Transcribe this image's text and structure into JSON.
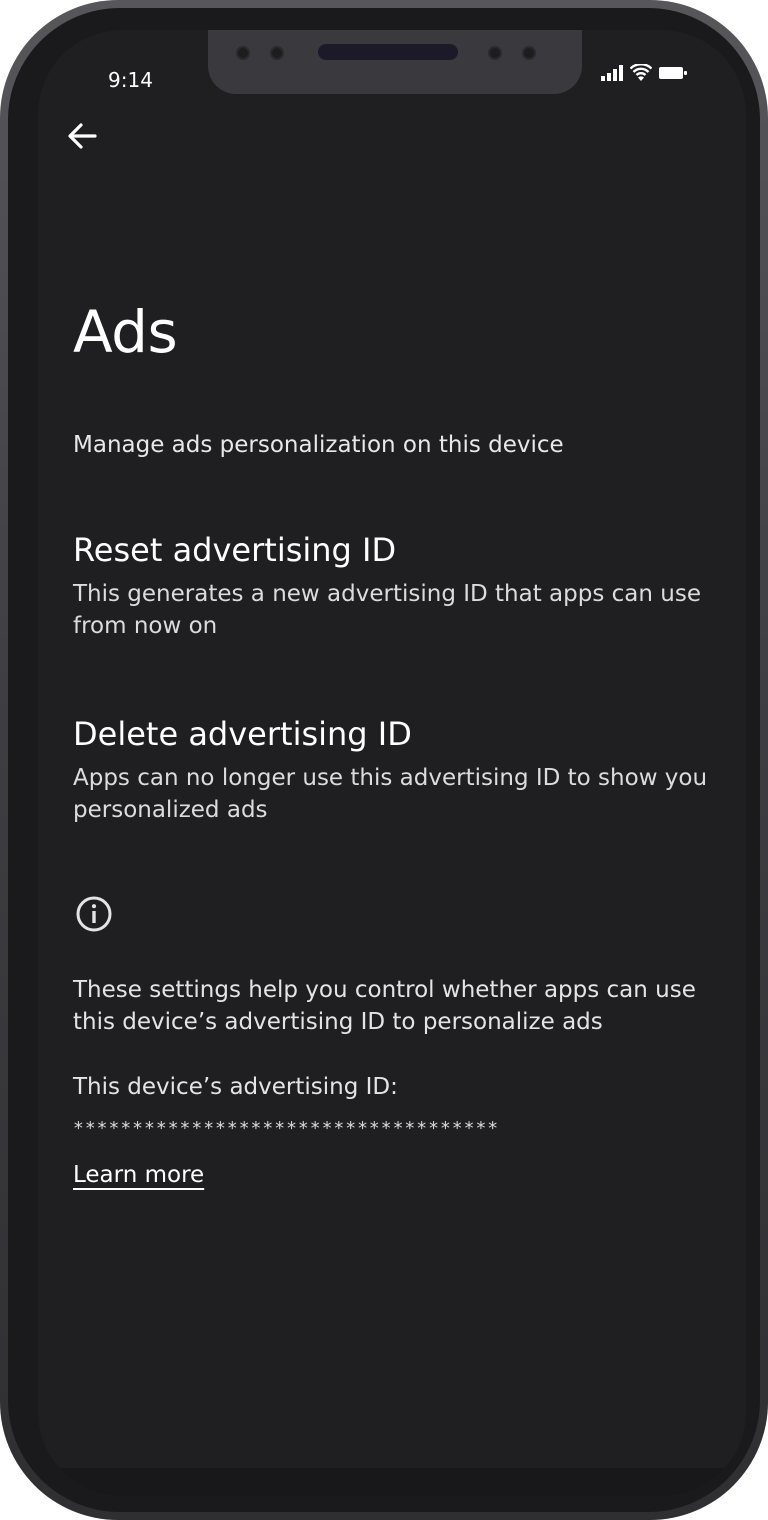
{
  "status_bar": {
    "time": "9:14",
    "icons": [
      "signal-icon",
      "wifi-icon",
      "battery-icon"
    ]
  },
  "navigation": {
    "back_icon": "back-arrow-icon"
  },
  "page": {
    "title": "Ads",
    "subtitle": "Manage ads personalization on this device"
  },
  "options": [
    {
      "title": "Reset advertising ID",
      "description": "This generates a new advertising ID that apps can use from now on"
    },
    {
      "title": "Delete advertising ID",
      "description": "Apps can no longer use this advertising ID to show you personalized ads"
    }
  ],
  "info": {
    "icon": "info-icon",
    "text": "These settings help you control whether apps can use this device’s advertising ID to personalize ads",
    "ad_id_label": "This device’s advertising ID:",
    "ad_id_value": "************************************",
    "learn_more": "Learn more"
  },
  "colors": {
    "screen_background": "#1f1f21",
    "text_primary": "#ffffff",
    "frame": "#3f3f43"
  }
}
